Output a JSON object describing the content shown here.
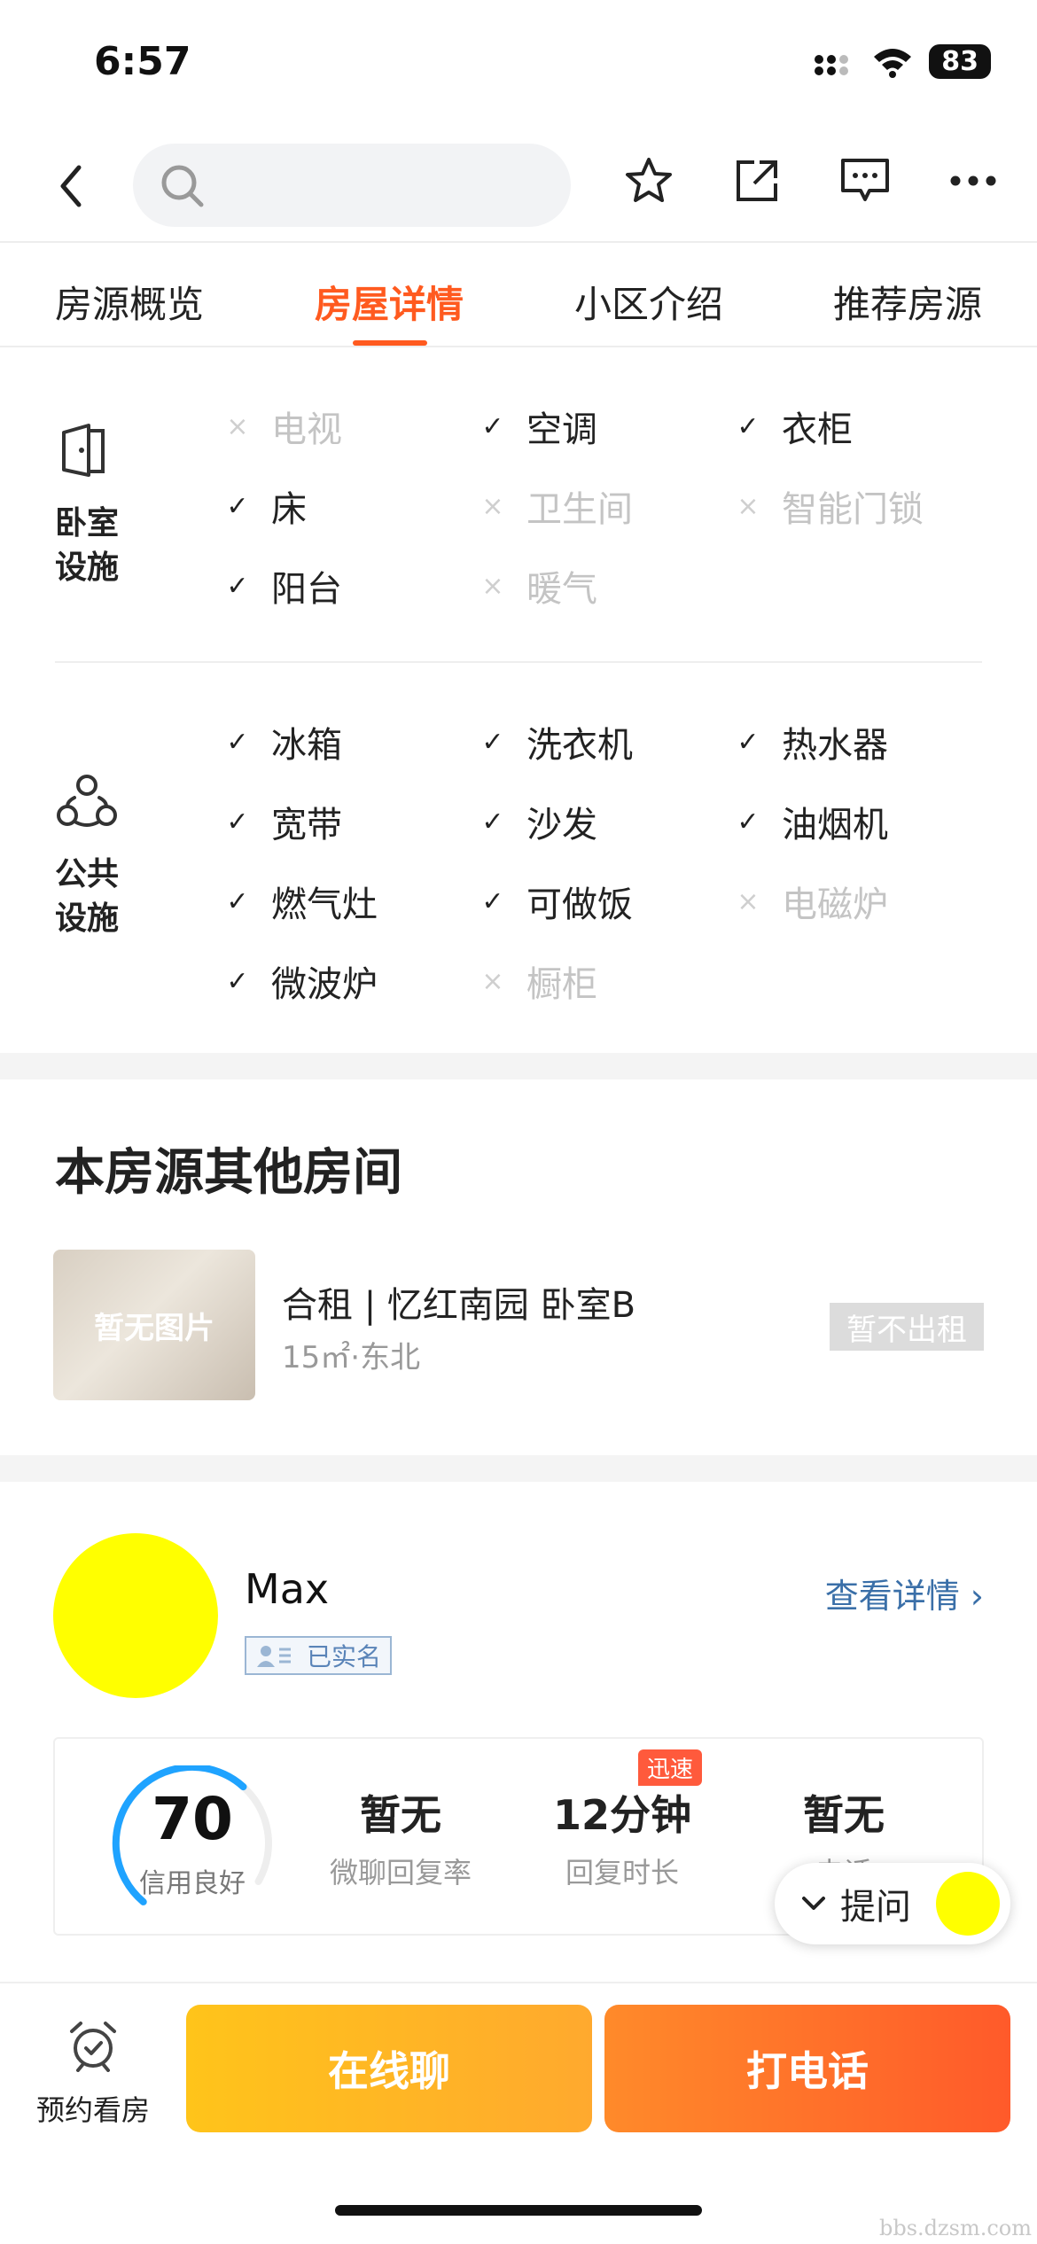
{
  "status_bar": {
    "time": "6:57",
    "battery": "83"
  },
  "tabs": [
    {
      "label": "房源概览",
      "active": false
    },
    {
      "label": "房屋详情",
      "active": true
    },
    {
      "label": "小区介绍",
      "active": false
    },
    {
      "label": "推荐房源",
      "active": false
    }
  ],
  "bedroom_facilities": {
    "label_line1": "卧室",
    "label_line2": "设施",
    "items": [
      {
        "name": "电视",
        "available": false
      },
      {
        "name": "空调",
        "available": true
      },
      {
        "name": "衣柜",
        "available": true
      },
      {
        "name": "床",
        "available": true
      },
      {
        "name": "卫生间",
        "available": false
      },
      {
        "name": "智能门锁",
        "available": false
      },
      {
        "name": "阳台",
        "available": true
      },
      {
        "name": "暖气",
        "available": false
      }
    ]
  },
  "public_facilities": {
    "label_line1": "公共",
    "label_line2": "设施",
    "items": [
      {
        "name": "冰箱",
        "available": true
      },
      {
        "name": "洗衣机",
        "available": true
      },
      {
        "name": "热水器",
        "available": true
      },
      {
        "name": "宽带",
        "available": true
      },
      {
        "name": "沙发",
        "available": true
      },
      {
        "name": "油烟机",
        "available": true
      },
      {
        "name": "燃气灶",
        "available": true
      },
      {
        "name": "可做饭",
        "available": true
      },
      {
        "name": "电磁炉",
        "available": false
      },
      {
        "name": "微波炉",
        "available": true
      },
      {
        "name": "橱柜",
        "available": false
      }
    ]
  },
  "marks": {
    "check": "✓",
    "cross": "×"
  },
  "other_rooms": {
    "title": "本房源其他房间",
    "rooms": [
      {
        "thumb_text": "暂无图片",
        "title": "合租 | 忆红南园 卧室B",
        "sub": "15㎡·东北",
        "status": "暂不出租"
      }
    ]
  },
  "landlord": {
    "name": "Max",
    "verified": "已实名",
    "view_detail": "查看详情 ›",
    "credit_score": "70",
    "credit_fraction": 0.7,
    "credit_label": "信用良好",
    "stats": [
      {
        "value": "暂无",
        "label": "微聊回复率"
      },
      {
        "value": "12分钟",
        "label": "回复时长",
        "badge": "迅速"
      },
      {
        "value": "暂无",
        "label": "电话"
      }
    ]
  },
  "ask_button": {
    "label": "提问"
  },
  "bottom_bar": {
    "appointment": "预约看房",
    "chat": "在线聊",
    "call": "打电话"
  },
  "watermark": "bbs.dzsm.com",
  "colors": {
    "accent": "#ff5a1f",
    "avatar": "#ffff00",
    "link": "#3a6fa8",
    "gauge": "#1fa3ff"
  },
  "icons": [
    "chevron-left-icon",
    "search-icon",
    "star-icon",
    "share-icon",
    "message-icon",
    "more-icon",
    "door-icon",
    "people-icon",
    "alarm-clock-icon",
    "chevron-down-icon"
  ]
}
